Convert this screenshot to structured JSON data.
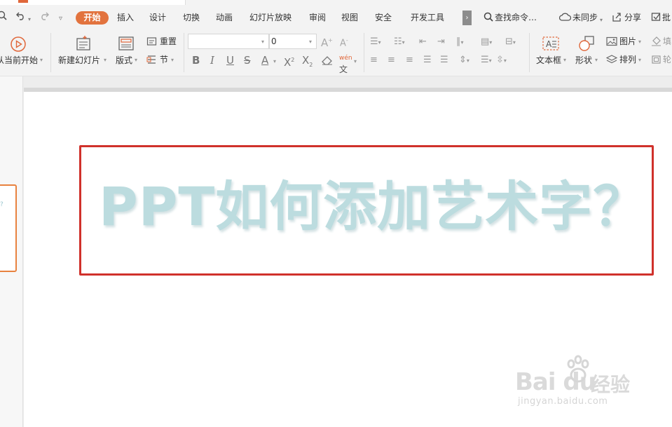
{
  "menu": {
    "tabs": [
      {
        "label": "开始",
        "active": true
      },
      {
        "label": "插入"
      },
      {
        "label": "设计"
      },
      {
        "label": "切换"
      },
      {
        "label": "动画"
      },
      {
        "label": "幻灯片放映"
      },
      {
        "label": "审阅"
      },
      {
        "label": "视图"
      },
      {
        "label": "安全"
      },
      {
        "label": "开发工具"
      }
    ],
    "search_label": "查找命令…",
    "sync_label": "未同步",
    "share_label": "分享",
    "comment_label": "批"
  },
  "ribbon": {
    "play_from_current_label": "从当前开始",
    "new_slide_label": "新建幻灯片",
    "layout_label": "版式",
    "reset_label": "重置",
    "section_label": "节",
    "font_name": "",
    "font_size": "0",
    "textbox_label": "文本框",
    "shape_label": "形状",
    "picture_label": "图片",
    "arrange_label": "排列",
    "fill_label": "填",
    "outline_label": "轮"
  },
  "slide": {
    "wordart_text": "PPT如何添加艺术字？",
    "thumbnail_char": "?"
  },
  "watermark": {
    "logo_text": "Bai du",
    "cn_text": "经验",
    "url": "jingyan.baidu.com"
  },
  "colors": {
    "accent": "#e2733e",
    "wordart": "#bcdcdf",
    "textbox_border": "#d0312b"
  }
}
